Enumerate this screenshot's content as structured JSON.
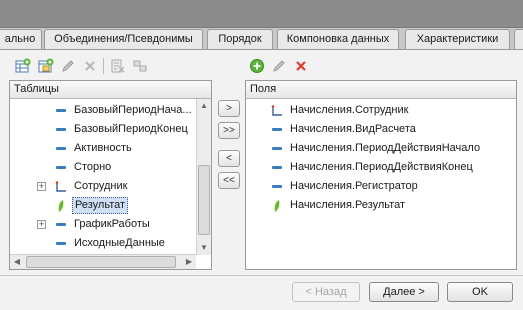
{
  "tabs": [
    {
      "label": "ально"
    },
    {
      "label": "Объединения/Псевдонимы"
    },
    {
      "label": "Порядок"
    },
    {
      "label": "Компоновка данных"
    },
    {
      "label": "Характеристики"
    },
    {
      "label": ""
    }
  ],
  "left_toolbar": {
    "icons": [
      "add-table-icon",
      "add-nested-icon",
      "edit-icon",
      "delete-icon",
      "query-icon",
      "link-icon"
    ]
  },
  "tables_panel": {
    "header": "Таблицы",
    "items": [
      {
        "label": "БазовыйПериодНача...",
        "icon": "field-icon",
        "expandable": false
      },
      {
        "label": "БазовыйПериодКонец",
        "icon": "field-icon",
        "expandable": false
      },
      {
        "label": "Активность",
        "icon": "field-icon",
        "expandable": false
      },
      {
        "label": "Сторно",
        "icon": "field-icon",
        "expandable": false
      },
      {
        "label": "Сотрудник",
        "icon": "dimension-icon",
        "expandable": true
      },
      {
        "label": "Результат",
        "icon": "resource-icon",
        "expandable": false,
        "selected": true
      },
      {
        "label": "ГрафикРаботы",
        "icon": "field-icon",
        "expandable": true
      },
      {
        "label": "ИсходныеДанные",
        "icon": "field-icon",
        "expandable": false
      }
    ]
  },
  "move_buttons": [
    ">",
    ">>",
    "<",
    "<<"
  ],
  "right_toolbar": {
    "icons": [
      "add-green-icon",
      "edit-icon",
      "delete-red-icon"
    ]
  },
  "fields_panel": {
    "header": "Поля",
    "items": [
      {
        "label": "Начисления.Сотрудник",
        "icon": "dimension-icon"
      },
      {
        "label": "Начисления.ВидРасчета",
        "icon": "field-icon"
      },
      {
        "label": "Начисления.ПериодДействияНачало",
        "icon": "field-icon"
      },
      {
        "label": "Начисления.ПериодДействияКонец",
        "icon": "field-icon"
      },
      {
        "label": "Начисления.Регистратор",
        "icon": "field-icon"
      },
      {
        "label": "Начисления.Результат",
        "icon": "resource-icon"
      }
    ]
  },
  "footer": {
    "back_label": "< Назад",
    "next_label": "Далее >",
    "ok_label": "OK"
  },
  "colors": {
    "field_icon": "#3a7cc0",
    "resource_icon": "#6cbb2f",
    "delete_icon": "#e03a2e",
    "selection": "#cfe0f5"
  }
}
